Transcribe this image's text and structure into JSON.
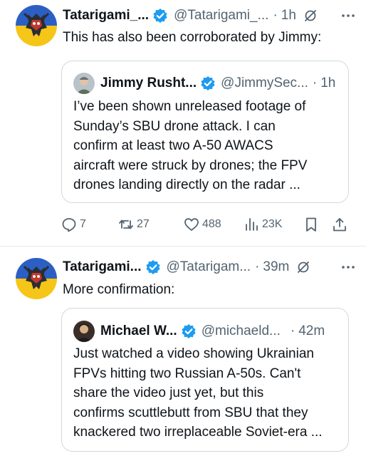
{
  "posts": [
    {
      "author": {
        "name": "Tatarigami_...",
        "handle": "@Tatarigami_...",
        "time": "1h"
      },
      "separator": "·",
      "text": "This has also been corroborated by Jimmy:",
      "quote": {
        "name": "Jimmy Rusht...",
        "handle": "@JimmySec...",
        "time": "1h",
        "lines": [
          "I’ve been shown unreleased footage of",
          "Sunday’s SBU drone attack. I can",
          "confirm at least two A-50 AWACS",
          "aircraft were struck by drones; the FPV",
          "drones landing directly on the radar ..."
        ]
      },
      "stats": {
        "replies": "7",
        "reposts": "27",
        "likes": "488",
        "views": "23K"
      }
    },
    {
      "author": {
        "name": "Tatarigami...",
        "handle": "@Tatarigam...",
        "time": "39m"
      },
      "separator": "·",
      "text": "More confirmation:",
      "quote": {
        "name": "Michael W...",
        "handle": "@michaeld...",
        "time": "42m",
        "separator": "·",
        "lines": [
          "Just watched a video showing Ukrainian",
          "FPVs hitting two Russian A-50s. Can't",
          "share the video just yet, but this",
          "confirms scuttlebutt from SBU that they",
          "knackered two irreplaceable Soviet-era ..."
        ]
      }
    }
  ],
  "icons": {
    "verified": "verified-badge-icon",
    "grok": "grok-icon",
    "more": "more-icon",
    "reply": "reply-icon",
    "repost": "repost-icon",
    "like": "heart-icon",
    "views": "views-icon",
    "bookmark": "bookmark-icon",
    "share": "share-icon"
  },
  "colors": {
    "verified_blue": "#1d9bf0",
    "secondary_text": "#536471",
    "primary_text": "#0f1419",
    "border": "#cfd9de",
    "flag_blue": "#2c5fc4",
    "flag_yellow": "#f5c518"
  }
}
